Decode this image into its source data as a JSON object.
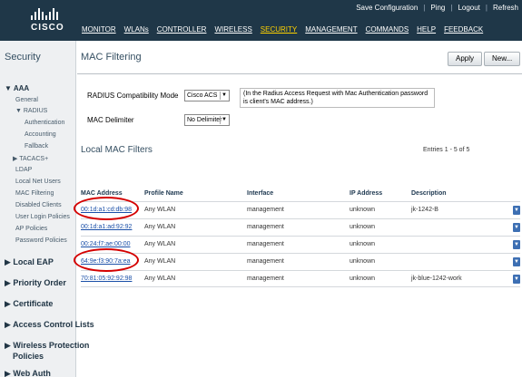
{
  "header": {
    "logo_text": "CISCO",
    "top_links": [
      "Save Configuration",
      "Ping",
      "Logout",
      "Refresh"
    ],
    "nav": [
      {
        "label": "MONITOR",
        "active": false
      },
      {
        "label": "WLANs",
        "active": false
      },
      {
        "label": "CONTROLLER",
        "active": false
      },
      {
        "label": "WIRELESS",
        "active": false
      },
      {
        "label": "SECURITY",
        "active": true
      },
      {
        "label": "MANAGEMENT",
        "active": false
      },
      {
        "label": "COMMANDS",
        "active": false
      },
      {
        "label": "HELP",
        "active": false
      },
      {
        "label": "FEEDBACK",
        "active": false
      }
    ]
  },
  "sidebar": {
    "title": "Security",
    "items": [
      {
        "label": "▼ AAA",
        "level": "head"
      },
      {
        "label": "General",
        "level": 1
      },
      {
        "label": "▼ RADIUS",
        "level": 1
      },
      {
        "label": "Authentication",
        "level": 2
      },
      {
        "label": "Accounting",
        "level": 2
      },
      {
        "label": "Fallback",
        "level": 2
      },
      {
        "label": "▶ TACACS+",
        "level": 1
      },
      {
        "label": "LDAP",
        "level": 1
      },
      {
        "label": "Local Net Users",
        "level": 1
      },
      {
        "label": "MAC Filtering",
        "level": 1
      },
      {
        "label": "Disabled Clients",
        "level": 1
      },
      {
        "label": "User Login Policies",
        "level": 1
      },
      {
        "label": "AP Policies",
        "level": 1
      },
      {
        "label": "Password Policies",
        "level": 1
      },
      {
        "label": "▶ Local EAP",
        "level": "big"
      },
      {
        "label": "▶ Priority Order",
        "level": "big"
      },
      {
        "label": "▶ Certificate",
        "level": "big"
      },
      {
        "label": "▶ Access Control Lists",
        "level": "big"
      },
      {
        "label": "▶ Wireless Protection",
        "level": "big"
      },
      {
        "label": "Policies",
        "level": "big"
      },
      {
        "label": "▶ Web Auth",
        "level": "big"
      }
    ]
  },
  "main": {
    "title": "MAC Filtering",
    "apply_label": "Apply",
    "new_label": "New...",
    "radius_label": "RADIUS Compatibility Mode",
    "radius_value": "Cisco ACS",
    "note": "(In the Radius Access Request with Mac Authentication password is client's MAC address.)",
    "delimiter_label": "MAC Delimiter",
    "delimiter_value": "No Delimiter",
    "section_title": "Local MAC Filters",
    "entries": "Entries 1 - 5 of 5",
    "columns": [
      "MAC Address",
      "Profile Name",
      "Interface",
      "IP Address",
      "Description"
    ],
    "rows": [
      {
        "mac": "00:1d:a1:cd:db:98",
        "profile": "Any WLAN",
        "interface": "management",
        "ip": "unknown",
        "description": "jk-1242-B",
        "circled": true
      },
      {
        "mac": "00:1d:a1:ad:92:92",
        "profile": "Any WLAN",
        "interface": "management",
        "ip": "unknown",
        "description": "",
        "circled": false
      },
      {
        "mac": "00:24:f7:ae:00:00",
        "profile": "Any WLAN",
        "interface": "management",
        "ip": "unknown",
        "description": "",
        "circled": false
      },
      {
        "mac": "64:9e:f3:90:7a:ea",
        "profile": "Any WLAN",
        "interface": "management",
        "ip": "unknown",
        "description": "",
        "circled": true
      },
      {
        "mac": "70:81:05:92:92:98",
        "profile": "Any WLAN",
        "interface": "management",
        "ip": "unknown",
        "description": "jk-blue-1242-work",
        "circled": false
      }
    ]
  }
}
